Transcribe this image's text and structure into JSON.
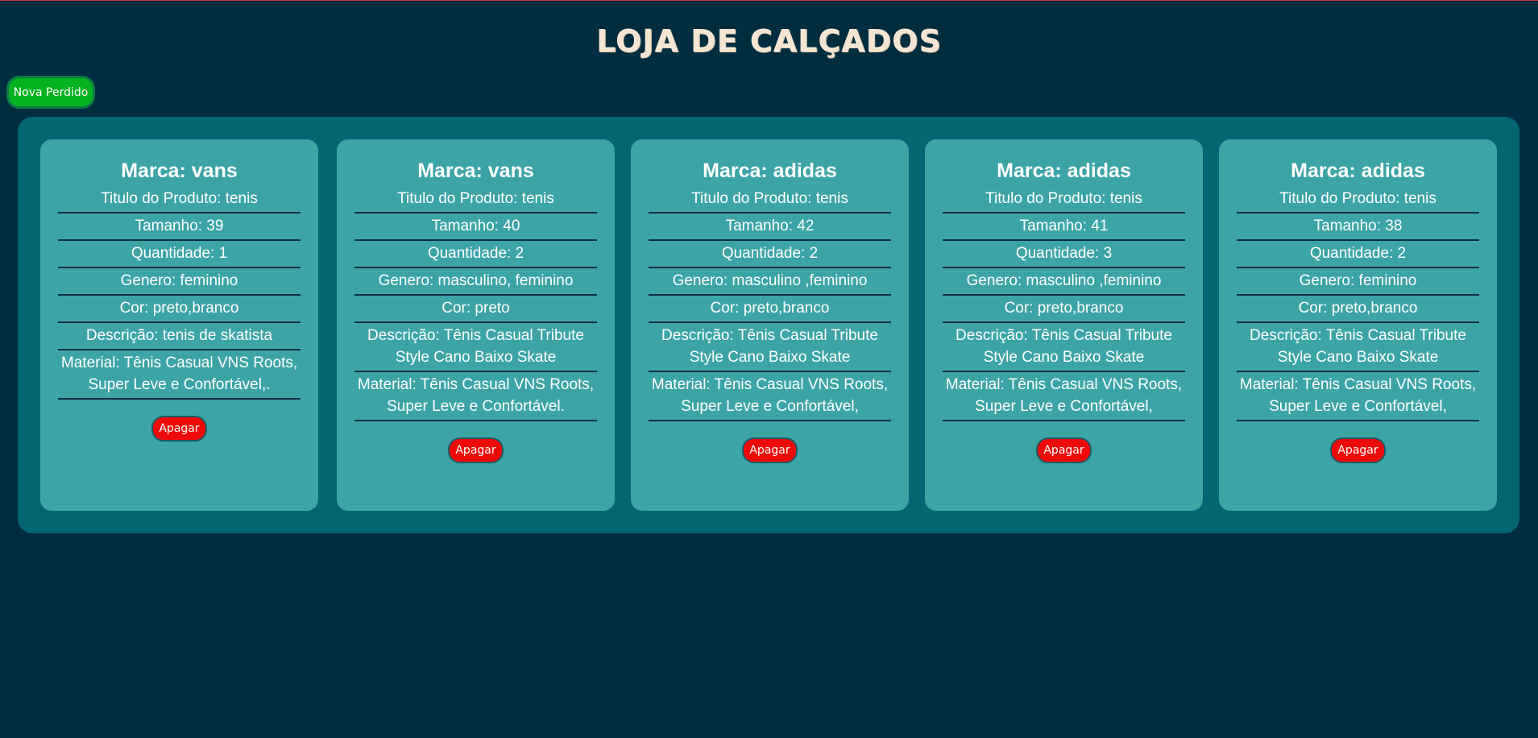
{
  "header": {
    "title": "LOJA DE CALÇADOS",
    "new_order_label": "Nova Perdido"
  },
  "cards": [
    {
      "marca": "Marca: vans",
      "titulo": "Titulo do Produto: tenis",
      "tamanho": "Tamanho: 39",
      "quantidade": "Quantidade: 1",
      "genero": "Genero: feminino",
      "cor": "Cor: preto,branco",
      "descricao": "Descrição: tenis de skatista",
      "material": "Material: Tênis Casual VNS Roots, Super Leve e Confortável,.",
      "delete_label": "Apagar"
    },
    {
      "marca": "Marca: vans",
      "titulo": "Titulo do Produto: tenis",
      "tamanho": "Tamanho: 40",
      "quantidade": "Quantidade: 2",
      "genero": "Genero: masculino, feminino",
      "cor": "Cor: preto",
      "descricao": "Descrição: Tênis Casual Tribute Style Cano Baixo Skate",
      "material": "Material: Tênis Casual VNS Roots, Super Leve e Confortável.",
      "delete_label": "Apagar"
    },
    {
      "marca": "Marca: adidas",
      "titulo": "Titulo do Produto: tenis",
      "tamanho": "Tamanho: 42",
      "quantidade": "Quantidade: 2",
      "genero": "Genero: masculino ,feminino",
      "cor": "Cor: preto,branco",
      "descricao": "Descrição: Tênis Casual Tribute Style Cano Baixo Skate",
      "material": "Material: Tênis Casual VNS Roots, Super Leve e Confortável,",
      "delete_label": "Apagar"
    },
    {
      "marca": "Marca: adidas",
      "titulo": "Titulo do Produto: tenis",
      "tamanho": "Tamanho: 41",
      "quantidade": "Quantidade: 3",
      "genero": "Genero: masculino ,feminino",
      "cor": "Cor: preto,branco",
      "descricao": "Descrição: Tênis Casual Tribute Style Cano Baixo Skate",
      "material": "Material: Tênis Casual VNS Roots, Super Leve e Confortável,",
      "delete_label": "Apagar"
    },
    {
      "marca": "Marca: adidas",
      "titulo": "Titulo do Produto: tenis",
      "tamanho": "Tamanho: 38",
      "quantidade": "Quantidade: 2",
      "genero": "Genero: feminino",
      "cor": "Cor: preto,branco",
      "descricao": "Descrição: Tênis Casual Tribute Style Cano Baixo Skate",
      "material": "Material: Tênis Casual VNS Roots, Super Leve e Confortável,",
      "delete_label": "Apagar"
    }
  ],
  "colors": {
    "background": "#002d3f",
    "panel": "#036671",
    "card": "#3da4a6",
    "new_button": "#05b21f",
    "delete_button": "#ef0a0a"
  }
}
